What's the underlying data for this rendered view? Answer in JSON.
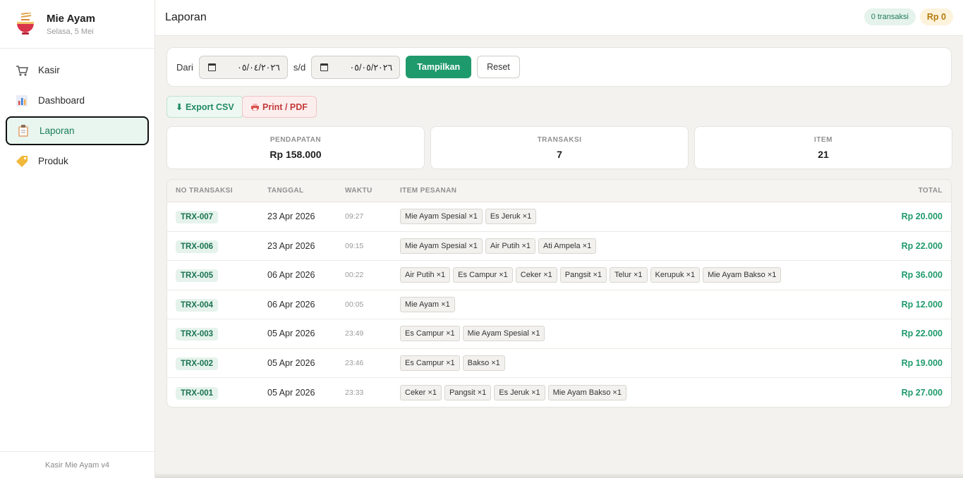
{
  "sidebar": {
    "app_name": "Mie Ayam",
    "date": "Selasa, 5 Mei",
    "items": [
      {
        "label": "Kasir",
        "icon": "cart-icon"
      },
      {
        "label": "Dashboard",
        "icon": "chart-icon"
      },
      {
        "label": "Laporan",
        "icon": "clipboard-icon"
      },
      {
        "label": "Produk",
        "icon": "tag-icon"
      }
    ],
    "active_index": 2,
    "footer": "Kasir Mie Ayam v4"
  },
  "header": {
    "title": "Laporan",
    "transactions_badge": "0 transaksi",
    "total_badge": "Rp 0"
  },
  "filter": {
    "from_label": "Dari",
    "from_value": "٠٥/٠٤/٢٠٢٦",
    "to_label": "s/d",
    "to_value": "٠٥/٠٥/٢٠٢٦",
    "show_button": "Tampilkan",
    "reset_button": "Reset"
  },
  "export": {
    "csv_label": "⬇ Export CSV",
    "pdf_label": "Print / PDF"
  },
  "stats": {
    "revenue_label": "PENDAPATAN",
    "revenue_value": "Rp 158.000",
    "transactions_label": "TRANSAKSI",
    "transactions_value": "7",
    "items_label": "ITEM",
    "items_value": "21"
  },
  "table": {
    "headers": {
      "no": "NO TRANSAKSI",
      "date": "TANGGAL",
      "time": "WAKTU",
      "items": "ITEM PESANAN",
      "total": "TOTAL"
    },
    "rows": [
      {
        "no": "TRX-007",
        "date": "23 Apr 2026",
        "time": "09:27",
        "items": [
          "Mie Ayam Spesial ×1",
          "Es Jeruk ×1"
        ],
        "total": "Rp 20.000"
      },
      {
        "no": "TRX-006",
        "date": "23 Apr 2026",
        "time": "09:15",
        "items": [
          "Mie Ayam Spesial ×1",
          "Air Putih ×1",
          "Ati Ampela ×1"
        ],
        "total": "Rp 22.000"
      },
      {
        "no": "TRX-005",
        "date": "06 Apr 2026",
        "time": "00:22",
        "items": [
          "Air Putih ×1",
          "Es Campur ×1",
          "Ceker ×1",
          "Pangsit ×1",
          "Telur ×1",
          "Kerupuk ×1",
          "Mie Ayam Bakso ×1"
        ],
        "total": "Rp 36.000"
      },
      {
        "no": "TRX-004",
        "date": "06 Apr 2026",
        "time": "00:05",
        "items": [
          "Mie Ayam ×1"
        ],
        "total": "Rp 12.000"
      },
      {
        "no": "TRX-003",
        "date": "05 Apr 2026",
        "time": "23:49",
        "items": [
          "Es Campur ×1",
          "Mie Ayam Spesial ×1"
        ],
        "total": "Rp 22.000"
      },
      {
        "no": "TRX-002",
        "date": "05 Apr 2026",
        "time": "23:46",
        "items": [
          "Es Campur ×1",
          "Bakso ×1"
        ],
        "total": "Rp 19.000"
      },
      {
        "no": "TRX-001",
        "date": "05 Apr 2026",
        "time": "23:33",
        "items": [
          "Ceker ×1",
          "Pangsit ×1",
          "Es Jeruk ×1",
          "Mie Ayam Bakso ×1"
        ],
        "total": "Rp 27.000"
      }
    ]
  },
  "colors": {
    "accent": "#1f9a6c",
    "danger": "#c43a3a",
    "warning": "#b57b0d"
  }
}
